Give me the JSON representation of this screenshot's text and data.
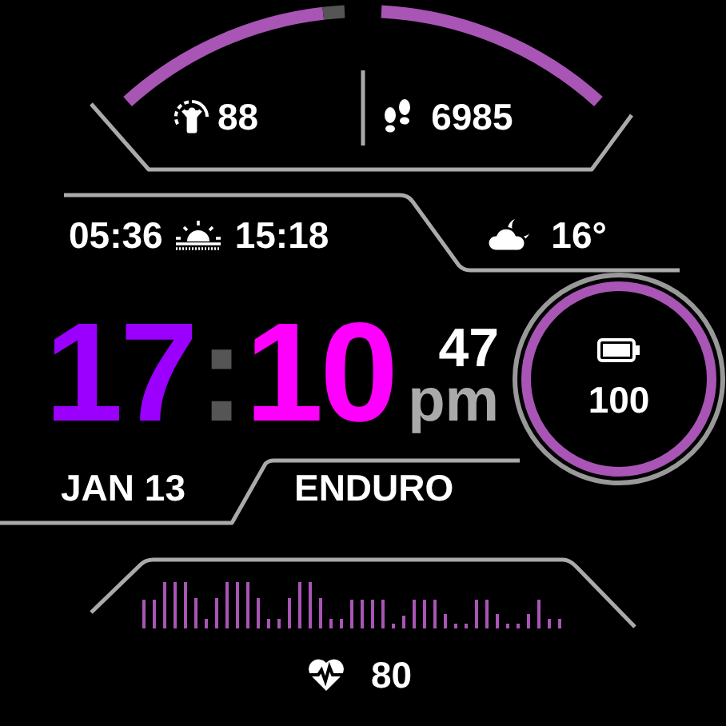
{
  "stats": [
    {
      "value": "88"
    },
    {
      "value": "6985"
    }
  ],
  "sun_times": [
    "05:36",
    "15:18"
  ],
  "weather": {
    "temperature": "16°"
  },
  "time": {
    "hours": "17",
    "separator": ":",
    "minutes": "10",
    "seconds": "47",
    "period": "pm"
  },
  "battery": {
    "value": "100"
  },
  "date": "JAN 13",
  "activity": "ENDURO",
  "heart_rate": {
    "value": "80"
  }
}
